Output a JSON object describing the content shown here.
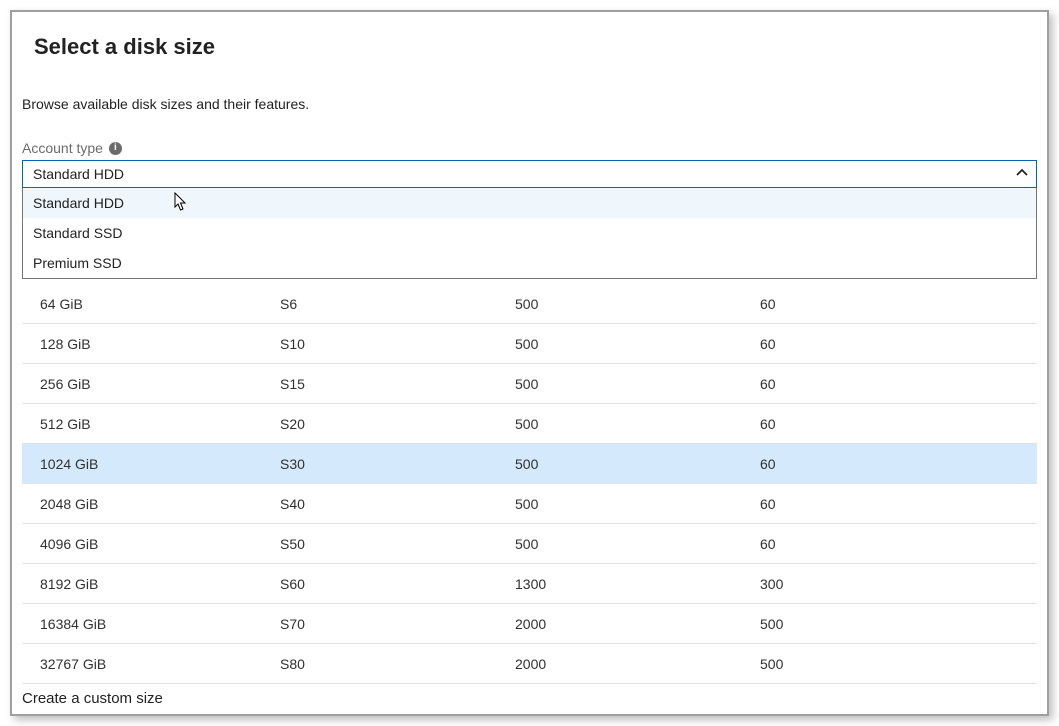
{
  "header": {
    "title": "Select a disk size",
    "description": "Browse available disk sizes and their features."
  },
  "accountType": {
    "label": "Account type",
    "selected": "Standard HDD",
    "options": [
      "Standard HDD",
      "Standard SSD",
      "Premium SSD"
    ],
    "highlightedIndex": 0
  },
  "table": {
    "rows": [
      {
        "size": "64 GiB",
        "tier": "S6",
        "iops": "500",
        "throughput": "60",
        "selected": false
      },
      {
        "size": "128 GiB",
        "tier": "S10",
        "iops": "500",
        "throughput": "60",
        "selected": false
      },
      {
        "size": "256 GiB",
        "tier": "S15",
        "iops": "500",
        "throughput": "60",
        "selected": false
      },
      {
        "size": "512 GiB",
        "tier": "S20",
        "iops": "500",
        "throughput": "60",
        "selected": false
      },
      {
        "size": "1024 GiB",
        "tier": "S30",
        "iops": "500",
        "throughput": "60",
        "selected": true
      },
      {
        "size": "2048 GiB",
        "tier": "S40",
        "iops": "500",
        "throughput": "60",
        "selected": false
      },
      {
        "size": "4096 GiB",
        "tier": "S50",
        "iops": "500",
        "throughput": "60",
        "selected": false
      },
      {
        "size": "8192 GiB",
        "tier": "S60",
        "iops": "1300",
        "throughput": "300",
        "selected": false
      },
      {
        "size": "16384 GiB",
        "tier": "S70",
        "iops": "2000",
        "throughput": "500",
        "selected": false
      },
      {
        "size": "32767 GiB",
        "tier": "S80",
        "iops": "2000",
        "throughput": "500",
        "selected": false
      }
    ]
  },
  "customSizeLink": "Create a custom size"
}
